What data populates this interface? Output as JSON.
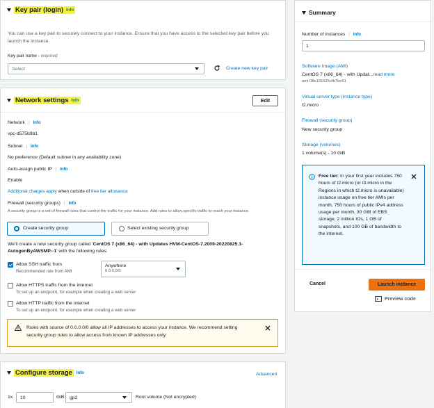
{
  "key_pair": {
    "title": "Key pair (login)",
    "info": "Info",
    "description": "You can use a key pair to securely connect to your instance. Ensure that you have access to the selected key pair before you launch the instance.",
    "name_label": "Key pair name",
    "required": "required",
    "select_placeholder": "Select",
    "create_link": "Create new key pair"
  },
  "network": {
    "title": "Network settings",
    "info": "Info",
    "edit_label": "Edit",
    "network_label": "Network",
    "network_info": "Info",
    "network_value": "vpc-d575b9b1",
    "subnet_label": "Subnet",
    "subnet_info": "Info",
    "subnet_value": "No preference (Default subnet in any availability zone)",
    "public_ip_label": "Auto-assign public IP",
    "public_ip_info": "Info",
    "public_ip_value": "Enable",
    "charges_link": "Additional charges apply",
    "charges_middle": " when outside of ",
    "free_tier_link": "free tier allowance",
    "firewall_label": "Firewall (security groups)",
    "firewall_info": "Info",
    "firewall_desc": "A security group is a set of firewall rules that control the traffic for your instance. Add rules to allow specific traffic to reach your instance.",
    "radio_create": "Create security group",
    "radio_existing": "Select existing security group",
    "create_note_1": "We'll create a new security group called '",
    "create_note_name": "CentOS 7 (x86_64) - with Updates HVM-CentOS-7.2009-20220825.1-AutogenByAWSMP--1",
    "create_note_2": "' with the following rules:",
    "ssh_label": "Allow SSH traffic from",
    "ssh_sub": "Recommended rule from AMI",
    "ssh_source": "Anywhere",
    "ssh_cidr": "0.0.0.0/0",
    "https_label": "Allow HTTPS traffic from the internet",
    "https_sub": "To set up an endpoint, for example when creating a web server",
    "http_label": "Allow HTTP traffic from the internet",
    "http_sub": "To set up an endpoint, for example when creating a web server",
    "warning_text": "Rules with source of 0.0.0.0/0 allow all IP addresses to access your instance. We recommend setting security group rules to allow access from known IP addresses only."
  },
  "storage": {
    "title": "Configure storage",
    "info": "Info",
    "advanced": "Advanced",
    "multiplier": "1x",
    "size": "10",
    "unit": "GiB",
    "volume_type": "gp2",
    "root_note": "Root volume  (Not encrypted)"
  },
  "summary": {
    "title": "Summary",
    "instances_label": "Number of instances",
    "instances_info": "Info",
    "instances_value": "1",
    "ami_label": "Software Image (AMI)",
    "ami_value": "CentOS 7 (x86_64) - with Updat...",
    "ami_more": "read more",
    "ami_id": "ami-08c191625cfb7ee61",
    "type_label": "Virtual server type (instance type)",
    "type_value": "t2.micro",
    "firewall_label": "Firewall (security group)",
    "firewall_value": "New security group",
    "storage_label": "Storage (volumes)",
    "storage_value": "1 volume(s) - 10 GiB",
    "free_tier_title": "Free tier:",
    "free_tier_body": " In your first year includes 750 hours of t2.micro (or t3.micro in the Regions in which t2.micro is unavailable) instance usage on free tier AMIs per month, 750 hours of public IPv4 address usage per month, 30 GiB of EBS storage, 2 million IOs, 1 GB of snapshots, and 100 GB of bandwidth to the internet.",
    "cancel_label": "Cancel",
    "launch_label": "Launch instance",
    "preview_label": "Preview code"
  },
  "colors": {
    "accent": "#0073bb",
    "primary": "#ec7211",
    "highlight": "#f6f33a",
    "warning_bg": "#fffbee",
    "warning_border": "#d4a51e",
    "info_bg": "#f1faff"
  }
}
